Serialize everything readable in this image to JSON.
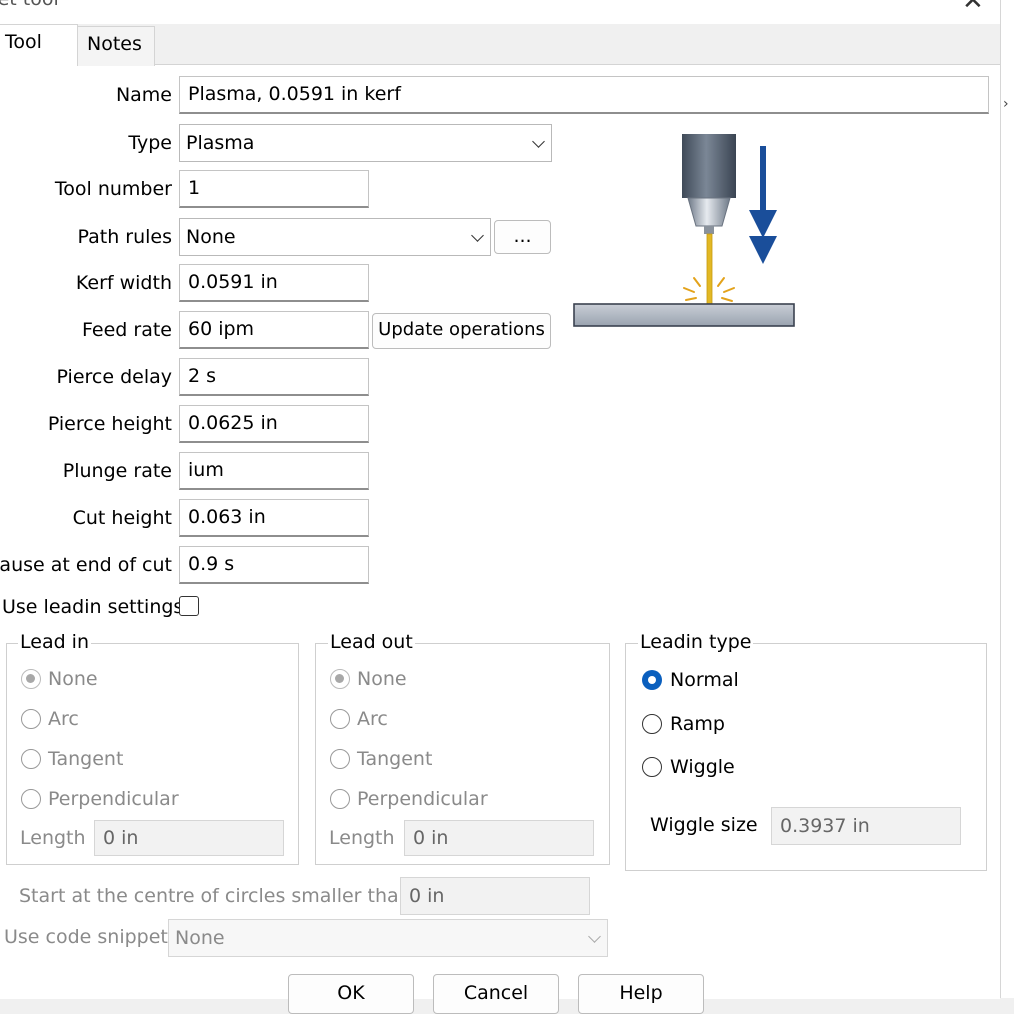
{
  "window": {
    "title": "Jet tool",
    "close": "✕"
  },
  "tabs": [
    {
      "label": "Tool"
    },
    {
      "label": "Notes"
    }
  ],
  "fields": {
    "name": {
      "label": "Name",
      "value": "Plasma, 0.0591 in kerf"
    },
    "type": {
      "label": "Type",
      "value": "Plasma"
    },
    "tool_number": {
      "label": "Tool number",
      "value": "1"
    },
    "path_rules": {
      "label": "Path rules",
      "value": "None",
      "button": "..."
    },
    "kerf_width": {
      "label": "Kerf width",
      "value": "0.0591 in"
    },
    "feed_rate": {
      "label": "Feed rate",
      "value": "60 ipm",
      "button": "Update operations"
    },
    "pierce_delay": {
      "label": "Pierce delay",
      "value": "2 s"
    },
    "pierce_height": {
      "label": "Pierce height",
      "value": "0.0625 in"
    },
    "plunge_rate": {
      "label": "Plunge rate",
      "value": "ium"
    },
    "cut_height": {
      "label": "Cut height",
      "value": "0.063 in"
    },
    "pause_end": {
      "label": "Pause at end of cut",
      "value": "0.9 s"
    },
    "use_leadin": {
      "label": "Use leadin settings",
      "checked": false
    }
  },
  "lead_in": {
    "title": "Lead in",
    "options": [
      "None",
      "Arc",
      "Tangent",
      "Perpendicular"
    ],
    "selected": "None",
    "length_label": "Length",
    "length_value": "0 in"
  },
  "lead_out": {
    "title": "Lead out",
    "options": [
      "None",
      "Arc",
      "Tangent",
      "Perpendicular"
    ],
    "selected": "None",
    "length_label": "Length",
    "length_value": "0 in"
  },
  "leadin_type": {
    "title": "Leadin type",
    "options": [
      "Normal",
      "Ramp",
      "Wiggle"
    ],
    "selected": "Normal",
    "wiggle_label": "Wiggle size",
    "wiggle_value": "0.3937 in"
  },
  "circles": {
    "label": "Start at the centre of circles smaller than",
    "value": "0 in"
  },
  "snippet": {
    "label": "Use code snippet",
    "value": "None"
  },
  "buttons": {
    "ok": "OK",
    "cancel": "Cancel",
    "help": "Help"
  },
  "colors": {
    "accent": "#0a5fbe",
    "arrow": "#1a4e9a",
    "spark": "#e3a21a"
  }
}
